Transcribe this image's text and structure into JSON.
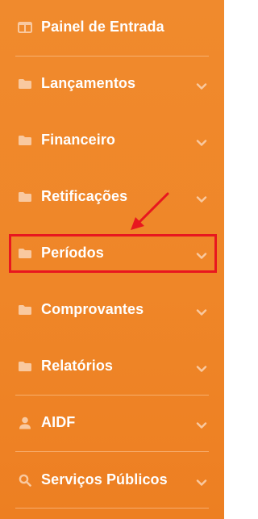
{
  "sidebar": {
    "items": [
      {
        "label": "Painel de Entrada",
        "icon": "dashboard-icon",
        "has_chevron": false
      },
      {
        "label": "Lançamentos",
        "icon": "folder-icon",
        "has_chevron": true
      },
      {
        "label": "Financeiro",
        "icon": "folder-icon",
        "has_chevron": true
      },
      {
        "label": "Retificações",
        "icon": "folder-icon",
        "has_chevron": true
      },
      {
        "label": "Períodos",
        "icon": "folder-icon",
        "has_chevron": true,
        "highlighted": true
      },
      {
        "label": "Comprovantes",
        "icon": "folder-icon",
        "has_chevron": true
      },
      {
        "label": "Relatórios",
        "icon": "folder-icon",
        "has_chevron": true
      },
      {
        "label": "AIDF",
        "icon": "user-icon",
        "has_chevron": true
      },
      {
        "label": "Serviços Públicos",
        "icon": "search-icon",
        "has_chevron": true
      }
    ]
  },
  "colors": {
    "sidebar_background": "#ef8628",
    "icon_color": "#f9c9a0",
    "chevron_color": "#f9c9a0",
    "text_color": "#ffffff",
    "highlight_color": "#e8171f"
  }
}
